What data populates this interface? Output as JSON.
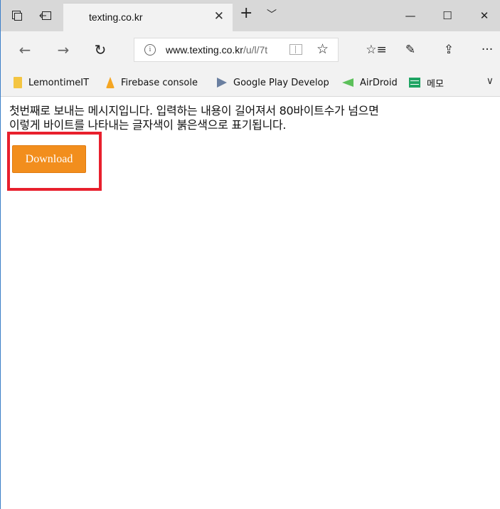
{
  "tabstrip": {
    "tab_title": "texting.co.kr",
    "close_glyph": "✕",
    "newtab_glyph": "+",
    "tabmenu_glyph": "﹀",
    "minimize_glyph": "—",
    "maximize_glyph": "☐",
    "closewin_glyph": "✕"
  },
  "navbar": {
    "address_host": "www.texting.co.kr",
    "address_path": "/u/l/7t",
    "info_glyph": "i",
    "back_glyph": "←",
    "forward_glyph": "→",
    "refresh_glyph": "↻",
    "favorite_glyph": "☆",
    "favorites_hub_glyph": "☆≡",
    "notes_glyph": "✎",
    "share_glyph": "⇪",
    "more_glyph": "···"
  },
  "favorites": {
    "items": [
      {
        "label": "LemontimeIT",
        "icon": "folder-icon"
      },
      {
        "label": "Firebase console",
        "icon": "firebase-icon"
      },
      {
        "label": "Google Play Develop",
        "icon": "google-play-icon"
      },
      {
        "label": "AirDroid",
        "icon": "airdroid-icon"
      },
      {
        "label": "메모",
        "icon": "sheets-icon"
      }
    ],
    "chevron_glyph": "∨"
  },
  "page": {
    "message_line1": "첫번째로 보내는 메시지입니다. 입력하는 내용이 길어져서 80바이트수가 넘으면",
    "message_line2": "이렇게 바이트를 나타내는 글자색이 붉은색으로 표기됩니다.",
    "download_label": "Download"
  },
  "colors": {
    "download_bg": "#f28e1d",
    "highlight": "#e8202d",
    "window_border": "#3c7fc8"
  }
}
